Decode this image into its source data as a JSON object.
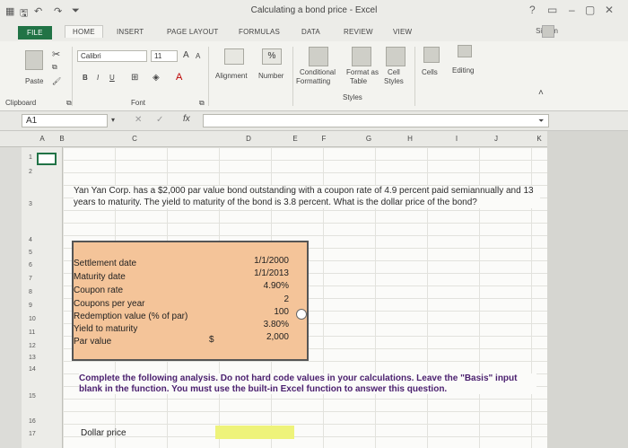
{
  "window": {
    "title": "Calculating a bond price - Excel",
    "help": "?",
    "controls": {
      "minimize": "–",
      "restore": "▢",
      "close": "✕"
    }
  },
  "tabs": [
    {
      "label": "FILE"
    },
    {
      "label": "HOME"
    },
    {
      "label": "INSERT"
    },
    {
      "label": "PAGE LAYOUT"
    },
    {
      "label": "FORMULAS"
    },
    {
      "label": "DATA"
    },
    {
      "label": "REVIEW"
    },
    {
      "label": "VIEW"
    }
  ],
  "signin": "Sign In",
  "ribbon": {
    "paste": "Paste",
    "clipboard": "Clipboard",
    "font_name": "Calibri",
    "font_size": "11",
    "font_group": "Font",
    "bold": "B",
    "italic": "I",
    "underline": "U",
    "grow_font": "A",
    "shrink_font": "A",
    "alignment": "Alignment",
    "number": "Number",
    "percent": "%",
    "conditional": "Conditional",
    "formatting": "Formatting",
    "format_as": "Format as",
    "table": "Table",
    "cell": "Cell",
    "styles": "Styles",
    "styles_group": "Styles",
    "cells": "Cells",
    "editing": "Editing"
  },
  "formula_bar": {
    "name_box": "A1",
    "fx": "fx",
    "cancel": "✕",
    "enter": "✓"
  },
  "columns": [
    "A",
    "B",
    "C",
    "D",
    "E",
    "F",
    "G",
    "H",
    "I",
    "J",
    "K"
  ],
  "rows": [
    "1",
    "2",
    "3",
    "4",
    "5",
    "6",
    "7",
    "8",
    "9",
    "10",
    "11",
    "12",
    "13",
    "14",
    "15",
    "16",
    "17"
  ],
  "problem": "Yan Yan Corp. has a $2,000 par value bond outstanding with a coupon rate of 4.9 percent paid semiannually and 13 years to maturity. The yield to maturity of the bond is 3.8 percent. What is the dollar price of the bond?",
  "data_table": [
    {
      "label": "Settlement date",
      "value": "1/1/2000"
    },
    {
      "label": "Maturity date",
      "value": "1/1/2013"
    },
    {
      "label": "Coupon rate",
      "value": "4.90%"
    },
    {
      "label": "Coupons per year",
      "value": "2"
    },
    {
      "label": "Redemption value (% of par)",
      "value": "100"
    },
    {
      "label": "Yield to maturity",
      "value": "3.80%"
    },
    {
      "label": "Par value",
      "value": "2,000",
      "prefix": "$"
    }
  ],
  "instruction": "Complete the following analysis. Do not hard code values in your calculations. Leave the \"Basis\" input blank in the function. You must use the built-in Excel function to answer this question.",
  "dollar_price_label": "Dollar price"
}
